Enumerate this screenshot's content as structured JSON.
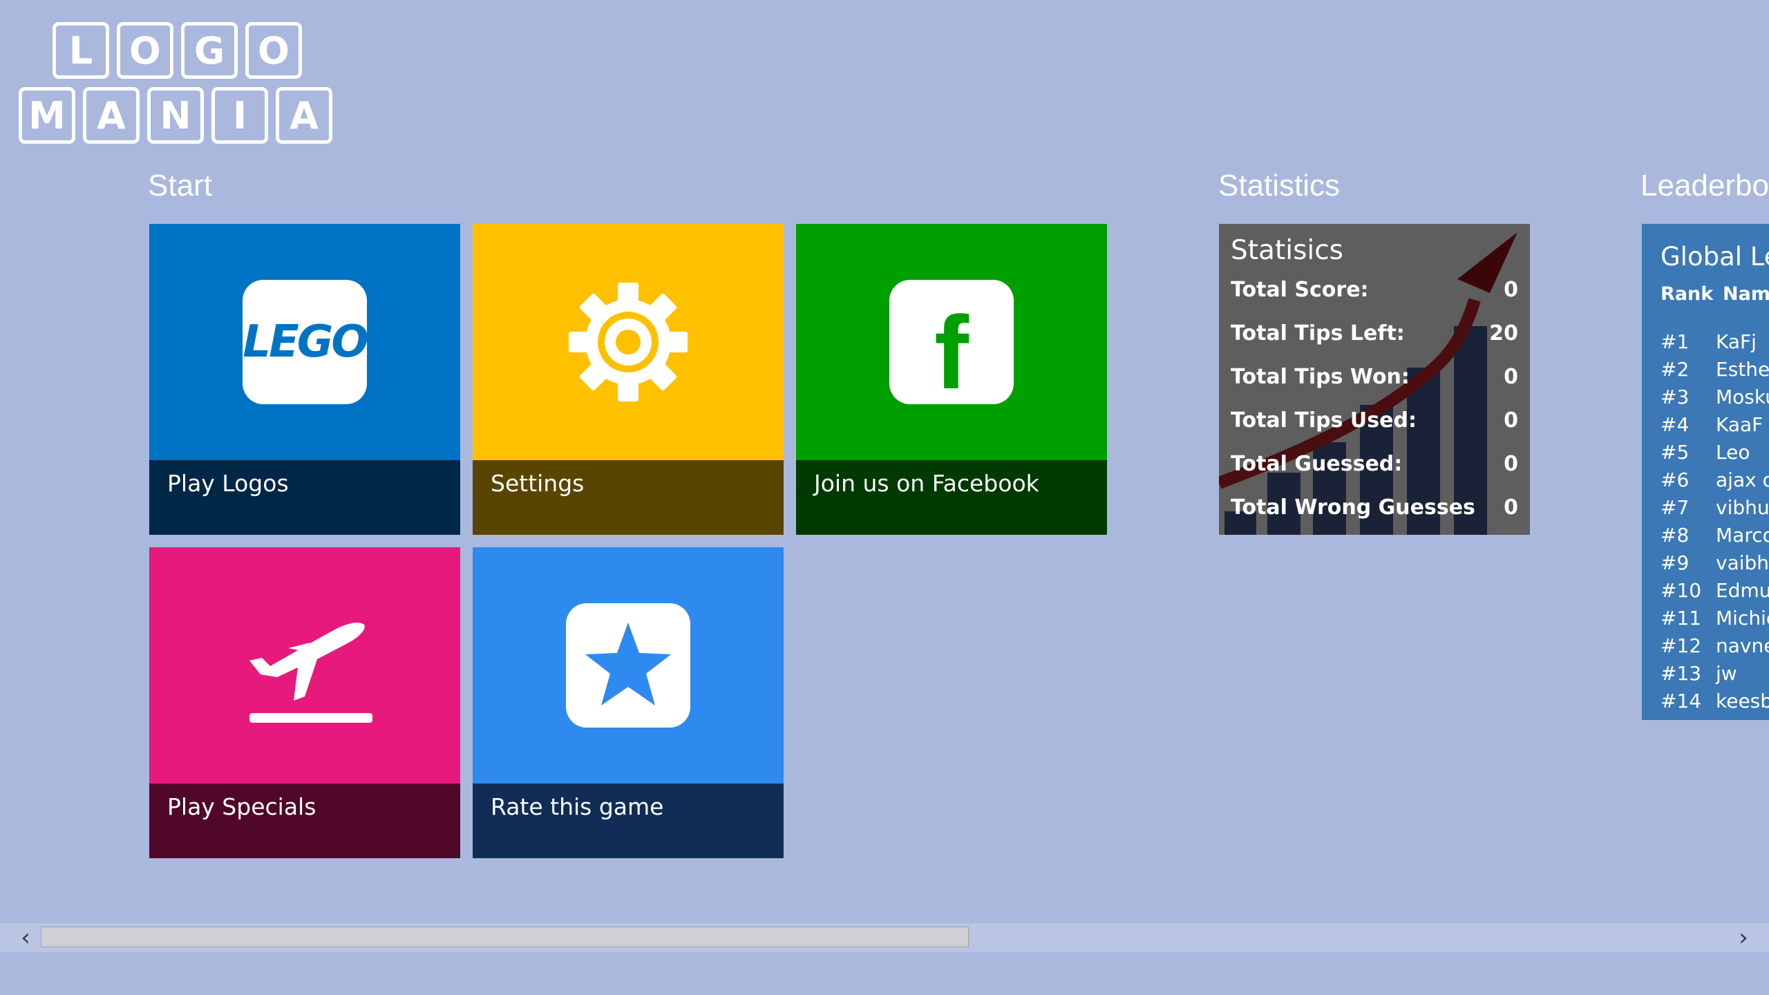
{
  "logo": {
    "row1": [
      "L",
      "O",
      "G",
      "O"
    ],
    "row2": [
      "M",
      "A",
      "N",
      "I",
      "A"
    ]
  },
  "sections": {
    "start": "Start",
    "statistics": "Statistics",
    "leaderboard": "Leaderbo"
  },
  "tiles": [
    {
      "label": "Play Logos",
      "icon": "lego-icon",
      "icon_text": "LEGO",
      "bg": "#0073C4",
      "bar": "#012747"
    },
    {
      "label": "Settings",
      "icon": "gear-icon",
      "bg": "#FFC000",
      "bar": "#5A4500"
    },
    {
      "label": "Join us on Facebook",
      "icon": "facebook-icon",
      "icon_text": "f",
      "bg": "#009F00",
      "bar": "#003A00"
    },
    {
      "label": "Play Specials",
      "icon": "airplane-takeoff-icon",
      "bg": "#E8197D",
      "bar": "#500728"
    },
    {
      "label": "Rate this game",
      "icon": "star-icon",
      "bg": "#2E8AEE",
      "bar": "#112D55"
    }
  ],
  "statistics": {
    "title": "Statisics",
    "rows": [
      {
        "label": "Total Score:",
        "value": "0"
      },
      {
        "label": "Total Tips Left:",
        "value": "20"
      },
      {
        "label": "Total Tips Won:",
        "value": "0"
      },
      {
        "label": "Total Tips Used:",
        "value": "0"
      },
      {
        "label": "Total Guessed:",
        "value": "0"
      },
      {
        "label": "Total Wrong Guesses",
        "value": "0"
      }
    ]
  },
  "leaderboard": {
    "title": "Global Le",
    "rank_header": "Rank",
    "name_header": "Nam",
    "rows": [
      {
        "rank": "#1",
        "name": "KaFj"
      },
      {
        "rank": "#2",
        "name": "Esther"
      },
      {
        "rank": "#3",
        "name": "Mosku"
      },
      {
        "rank": "#4",
        "name": "KaaF"
      },
      {
        "rank": "#5",
        "name": "Leo"
      },
      {
        "rank": "#6",
        "name": "ajax o"
      },
      {
        "rank": "#7",
        "name": "vibhu"
      },
      {
        "rank": "#8",
        "name": "Marco"
      },
      {
        "rank": "#9",
        "name": "vaibha"
      },
      {
        "rank": "#10",
        "name": "Edmun"
      },
      {
        "rank": "#11",
        "name": "Michie"
      },
      {
        "rank": "#12",
        "name": "navne"
      },
      {
        "rank": "#13",
        "name": "jw"
      },
      {
        "rank": "#14",
        "name": "keesb"
      }
    ]
  },
  "scrollbar": {
    "left_arrow": "‹",
    "right_arrow": "›"
  },
  "colors": {
    "background": "#AAB8DE",
    "stats_bg": "#5E5E5E",
    "leaderboard_bg": "#3B78B5"
  }
}
